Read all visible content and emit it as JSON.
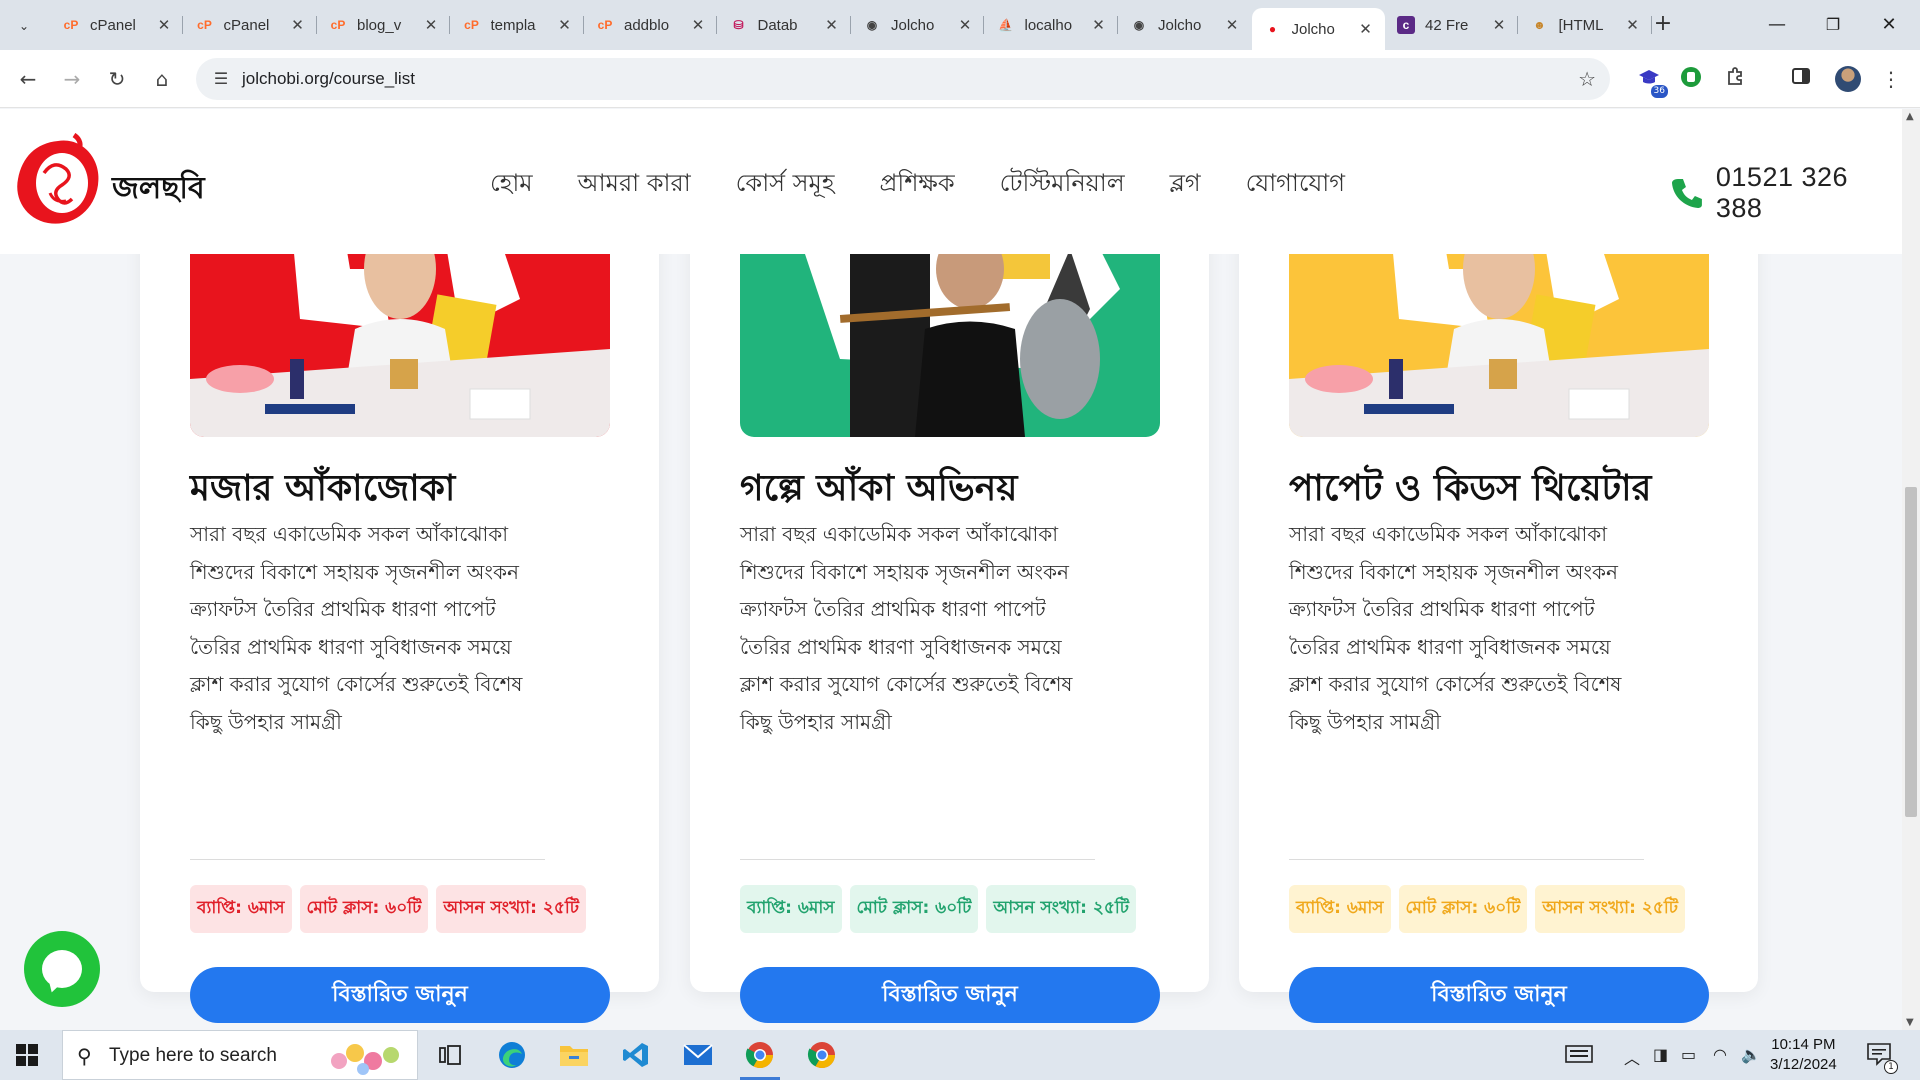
{
  "browser": {
    "tabs": [
      {
        "label": "cPanel",
        "icon": "cpanel-icon"
      },
      {
        "label": "cPanel",
        "icon": "cpanel-icon"
      },
      {
        "label": "blog_v",
        "icon": "cpanel-icon"
      },
      {
        "label": "templa",
        "icon": "cpanel-icon"
      },
      {
        "label": "addblo",
        "icon": "cpanel-icon"
      },
      {
        "label": "Datab",
        "icon": "database-icon"
      },
      {
        "label": "Jolcho",
        "icon": "globe-icon"
      },
      {
        "label": "localho",
        "icon": "phpmyadmin-icon"
      },
      {
        "label": "Jolcho",
        "icon": "globe-icon"
      },
      {
        "label": "Jolcho",
        "icon": "jolchobi-icon"
      },
      {
        "label": "42 Fre",
        "icon": "colorlib-icon"
      },
      {
        "label": "[HTML",
        "icon": "stackoverflow-icon"
      }
    ],
    "active_tab_index": 9,
    "url": "jolchobi.org/course_list",
    "extension_badge": "36"
  },
  "site": {
    "logo_text": "জলছবি",
    "nav": [
      "হোম",
      "আমরা কারা",
      "কোর্স সমূহ",
      "প্রশিক্ষক",
      "টেস্টিমনিয়াল",
      "ব্লগ",
      "যোগাযোগ"
    ],
    "phone": "01521 326 388"
  },
  "courses": [
    {
      "title": "মজার আঁকাজোকা",
      "description": "সারা বছর একাডেমিক সকল আঁকাঝোকা শিশুদের বিকাশে সহায়ক সৃজনশীল অংকন ক্র্যাফটস তৈরির প্রাথমিক ধারণা পাপেট তৈরির প্রাথমিক ধারণা সুবিধাজনক সময়ে ক্লাশ করার সুযোগ কোর্সের শুরুতেই বিশেষ কিছু উপহার সামগ্রী",
      "badges": [
        "ব্যাপ্তি: ৬মাস",
        "মোট ক্লাস: ৬০টি",
        "আসন সংখ্যা: ২৫টি"
      ],
      "button": "বিস্তারিত জানুন",
      "accent": "#e8141d",
      "badge_bg": "#fde3e4",
      "badge_color": "#e0202a"
    },
    {
      "title": "গল্পে আঁকা অভিনয়",
      "description": "সারা বছর একাডেমিক সকল আঁকাঝোকা শিশুদের বিকাশে সহায়ক সৃজনশীল অংকন ক্র্যাফটস তৈরির প্রাথমিক ধারণা পাপেট তৈরির প্রাথমিক ধারণা সুবিধাজনক সময়ে ক্লাশ করার সুযোগ কোর্সের শুরুতেই বিশেষ কিছু উপহার সামগ্রী",
      "badges": [
        "ব্যাপ্তি: ৬মাস",
        "মোট ক্লাস: ৬০টি",
        "আসন সংখ্যা: ২৫টি"
      ],
      "button": "বিস্তারিত জানুন",
      "accent": "#21b47c",
      "badge_bg": "#e2f6ed",
      "badge_color": "#22a36e"
    },
    {
      "title": "পাপেট ও কিডস থিয়েটার",
      "description": "সারা বছর একাডেমিক সকল আঁকাঝোকা শিশুদের বিকাশে সহায়ক সৃজনশীল অংকন ক্র্যাফটস তৈরির প্রাথমিক ধারণা পাপেট তৈরির প্রাথমিক ধারণা সুবিধাজনক সময়ে ক্লাশ করার সুযোগ কোর্সের শুরুতেই বিশেষ কিছু উপহার সামগ্রী",
      "badges": [
        "ব্যাপ্তি: ৬মাস",
        "মোট ক্লাস: ৬০টি",
        "আসন সংখ্যা: ২৫টি"
      ],
      "button": "বিস্তারিত জানুন",
      "accent": "#fcc43a",
      "badge_bg": "#fff3d1",
      "badge_color": "#f0a81c"
    }
  ],
  "taskbar": {
    "search_placeholder": "Type here to search",
    "time": "10:14 PM",
    "date": "3/12/2024",
    "notification_count": "1"
  }
}
